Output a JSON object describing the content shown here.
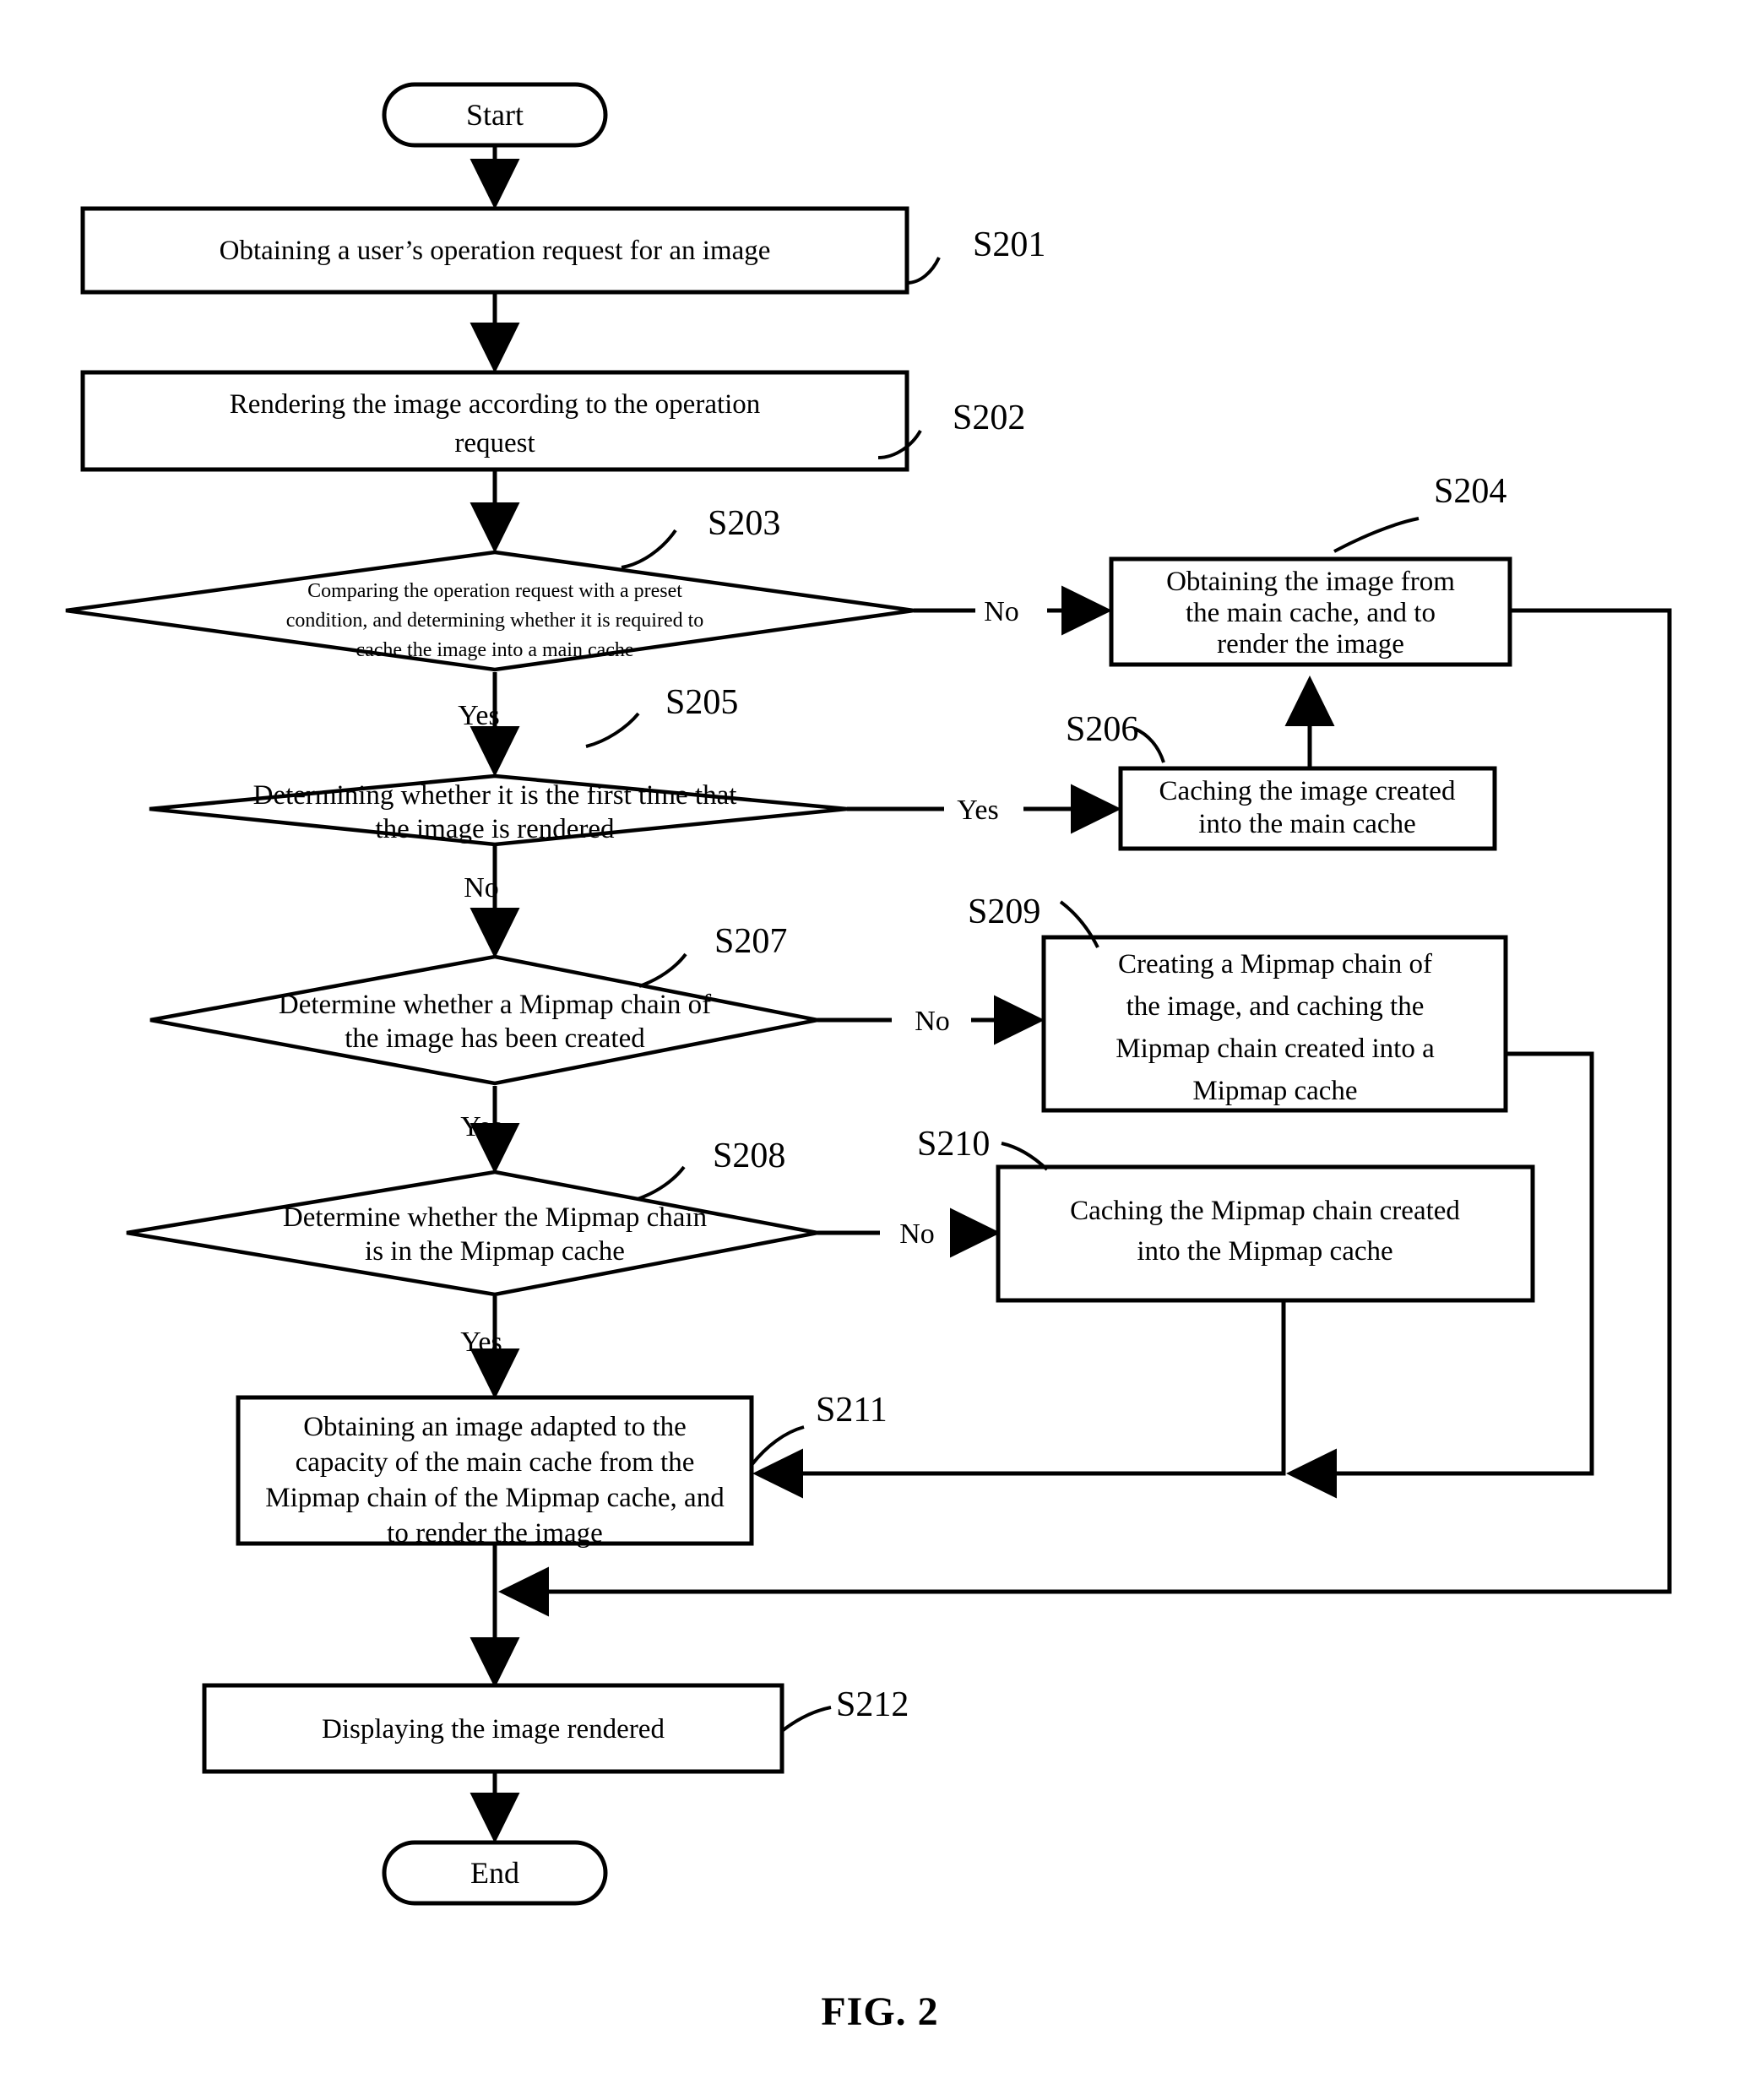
{
  "figure": {
    "caption": "FIG. 2",
    "terminals": {
      "start": "Start",
      "end": "End"
    },
    "branch_labels": {
      "s203_no": "No",
      "s203_yes": "Yes",
      "s205_yes": "Yes",
      "s205_no": "No",
      "s207_no": "No",
      "s207_yes": "Yes",
      "s208_no": "No",
      "s208_yes": "Yes"
    },
    "steps": [
      {
        "id": "S201",
        "tag": "S201",
        "type": "process",
        "lines": [
          "Obtaining a user’s operation request for an image"
        ]
      },
      {
        "id": "S202",
        "tag": "S202",
        "type": "process",
        "lines": [
          "Rendering the image according to the operation",
          "request"
        ]
      },
      {
        "id": "S203",
        "tag": "S203",
        "type": "decision",
        "lines": [
          "Comparing the operation request with a preset",
          "condition, and determining whether it is required to",
          "cache the image into a main cache"
        ]
      },
      {
        "id": "S204",
        "tag": "S204",
        "type": "process",
        "lines": [
          "Obtaining the image from",
          "the main cache, and to",
          "render the image"
        ]
      },
      {
        "id": "S205",
        "tag": "S205",
        "type": "decision",
        "lines": [
          "Determining whether it is the first time that",
          "the image is rendered"
        ]
      },
      {
        "id": "S206",
        "tag": "S206",
        "type": "process",
        "lines": [
          "Caching the image created",
          "into the main cache"
        ]
      },
      {
        "id": "S207",
        "tag": "S207",
        "type": "decision",
        "lines": [
          "Determine whether a Mipmap chain of",
          "the image has been created"
        ]
      },
      {
        "id": "S208",
        "tag": "S208",
        "type": "decision",
        "lines": [
          "Determine whether the Mipmap chain",
          "is in the Mipmap cache"
        ]
      },
      {
        "id": "S209",
        "tag": "S209",
        "type": "process",
        "lines": [
          "Creating a Mipmap chain of",
          "the image, and caching the",
          "Mipmap chain created into a",
          "Mipmap cache"
        ]
      },
      {
        "id": "S210",
        "tag": "S210",
        "type": "process",
        "lines": [
          "Caching the Mipmap chain created",
          "into the Mipmap cache"
        ]
      },
      {
        "id": "S211",
        "tag": "S211",
        "type": "process",
        "lines": [
          "Obtaining an image adapted to the",
          "capacity of the main cache from the",
          "Mipmap chain of the Mipmap cache, and",
          "to render the image"
        ]
      },
      {
        "id": "S212",
        "tag": "S212",
        "type": "process",
        "lines": [
          "Displaying the image rendered"
        ]
      }
    ]
  }
}
